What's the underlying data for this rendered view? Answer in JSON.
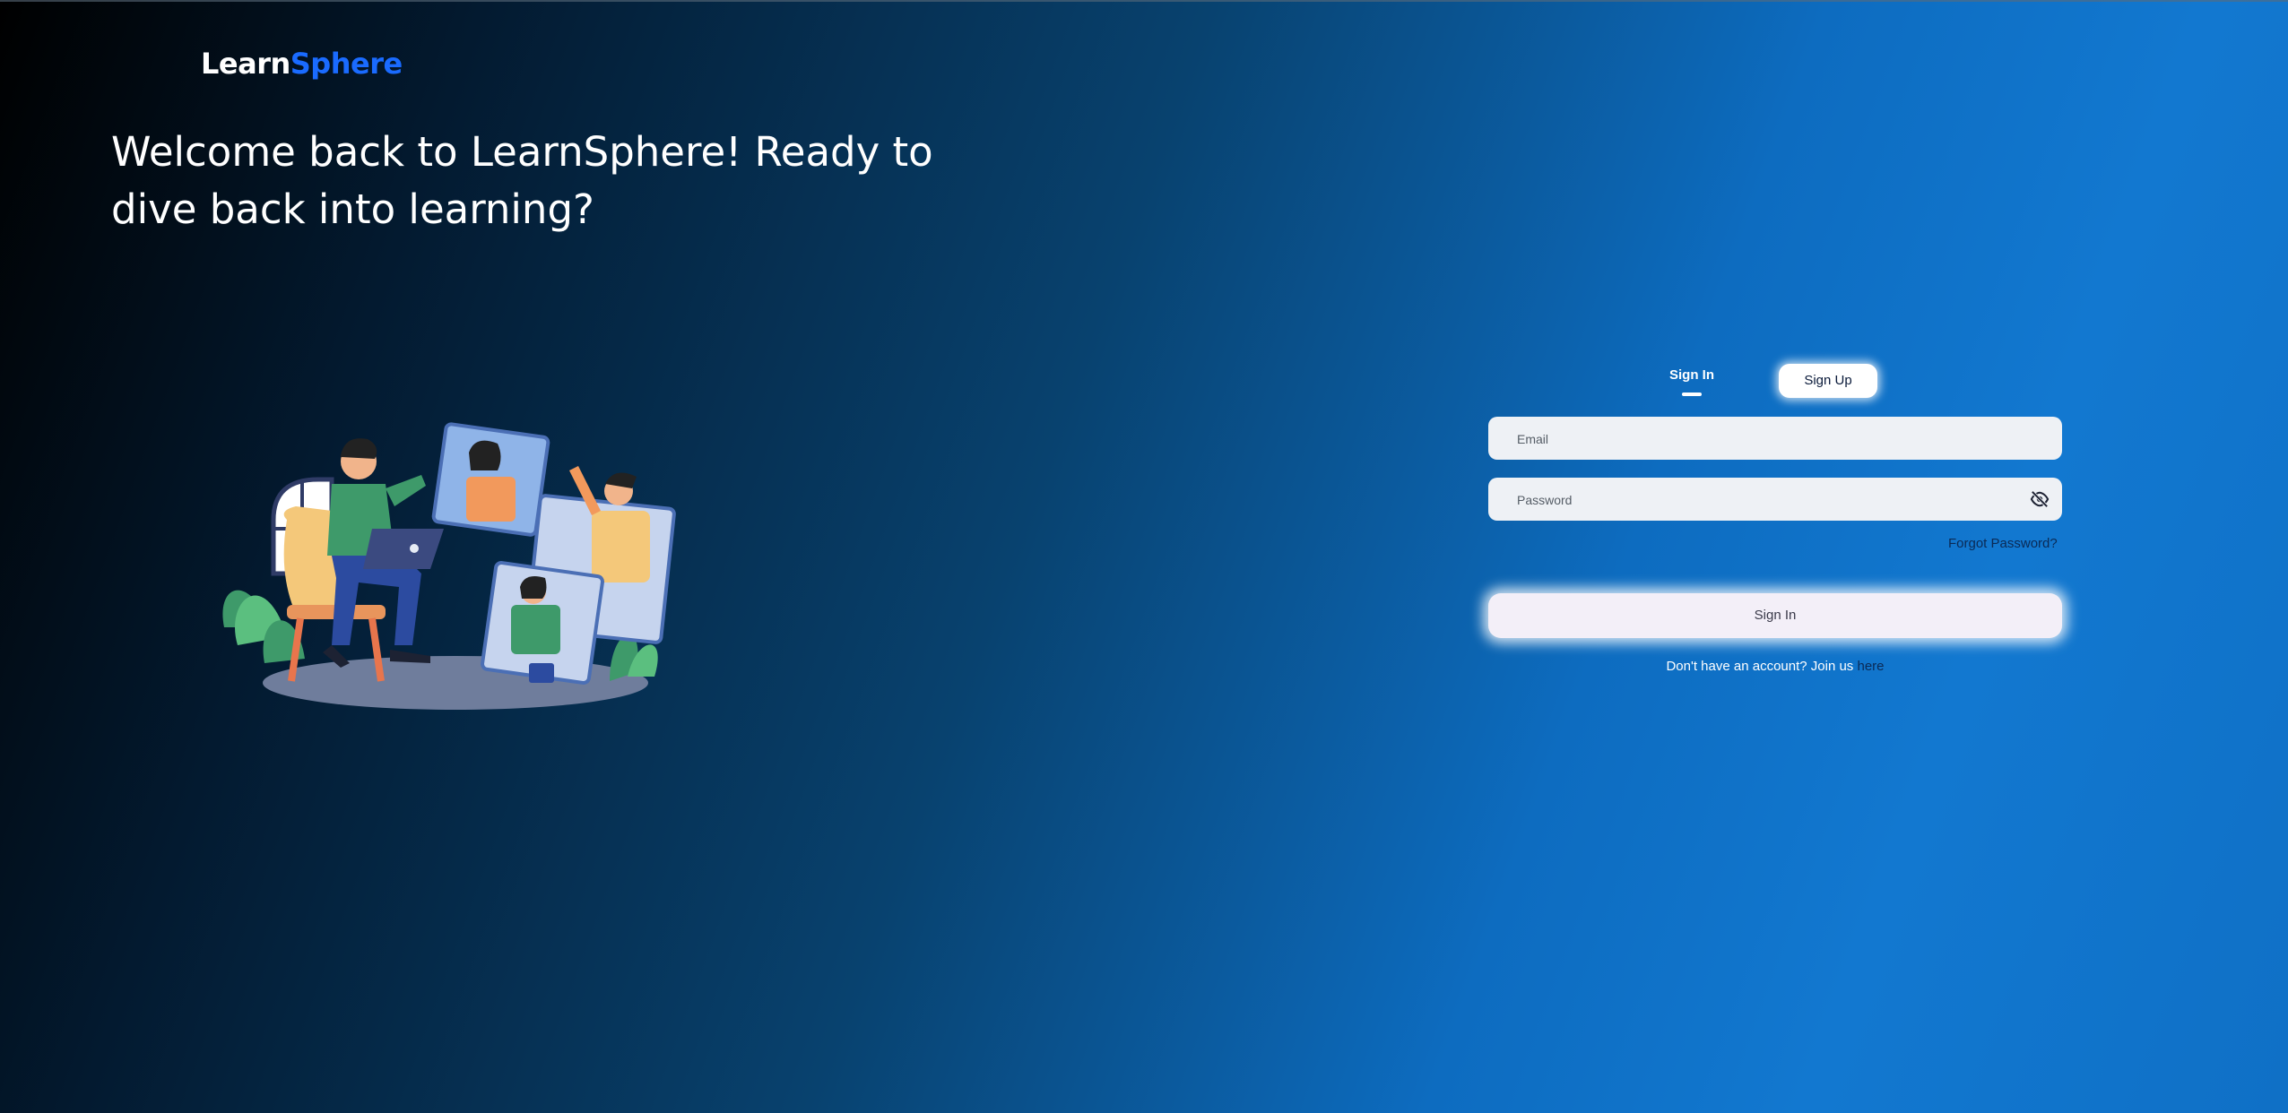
{
  "brand": {
    "part1": "Learn",
    "part2": "Sphere",
    "accent_color": "#1a6bff"
  },
  "hero": {
    "headline": "Welcome back to LearnSphere! Ready to dive back into learning?"
  },
  "auth": {
    "tabs": [
      {
        "label": "Sign In",
        "active": true
      },
      {
        "label": "Sign Up",
        "active": false
      }
    ],
    "email": {
      "placeholder": "Email",
      "value": ""
    },
    "password": {
      "placeholder": "Password",
      "value": "",
      "toggle_icon": "eye-off-icon"
    },
    "forgot_password": "Forgot Password?",
    "submit_label": "Sign In",
    "join_prompt": "Don't have an account? Join us ",
    "join_link": "here"
  },
  "colors": {
    "background_dark": "#000000",
    "background_blue": "#1278d0",
    "link_color": "#0b2a55"
  }
}
